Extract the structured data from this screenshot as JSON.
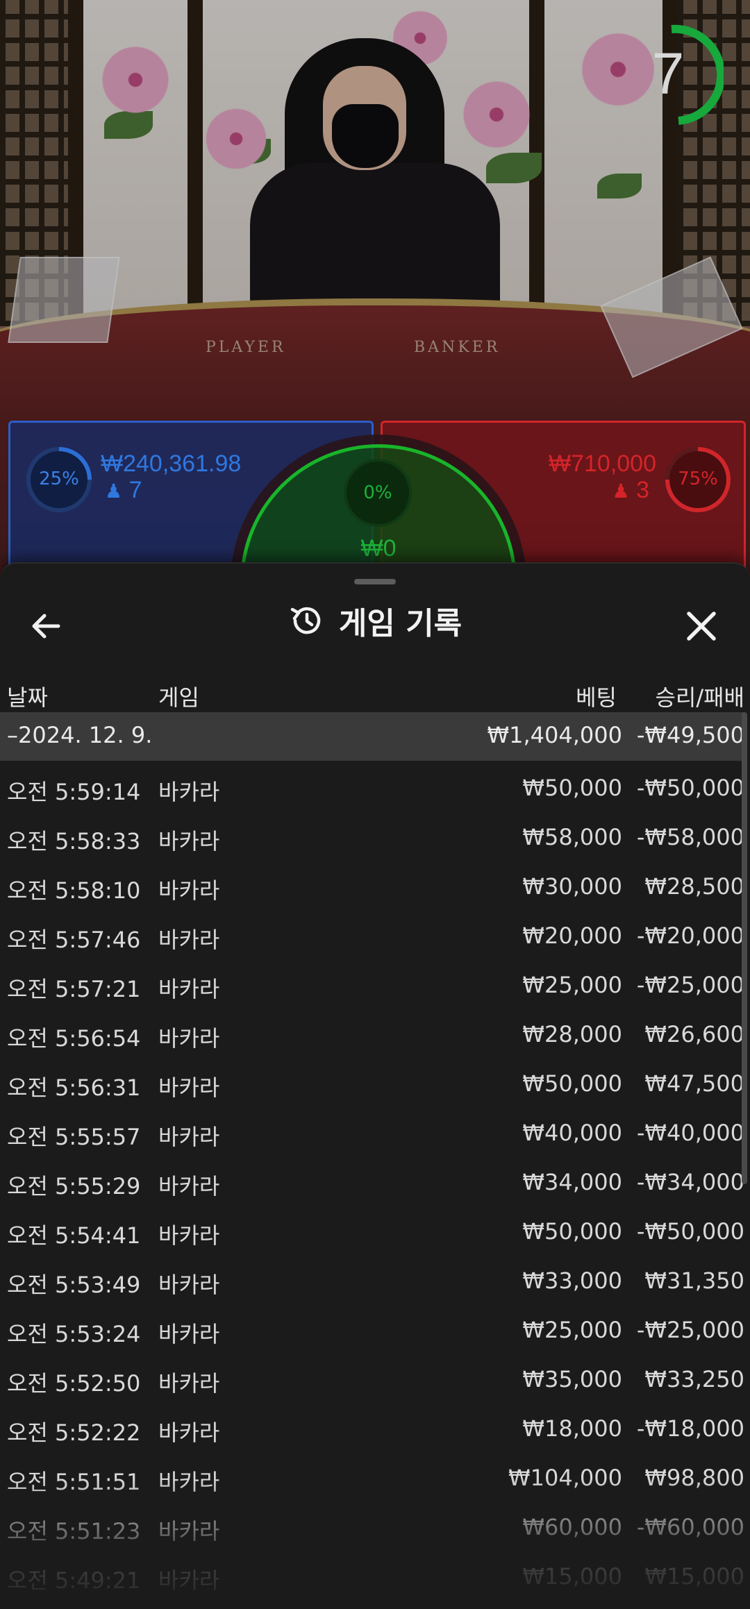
{
  "video": {
    "timer_value": "7",
    "table_labels": {
      "player": "PLAYER",
      "banker": "BANKER"
    },
    "player": {
      "amount": "₩240,361.98",
      "players": "7",
      "percent": "25%",
      "percent_value": 0.25,
      "color": "#2b6fd6"
    },
    "banker": {
      "amount": "₩710,000",
      "players": "3",
      "percent": "75%",
      "percent_value": 0.75,
      "color": "#d0262b"
    },
    "tie": {
      "percent": "0%",
      "amount": "₩0",
      "color": "#1db33a"
    }
  },
  "sheet": {
    "title": "게임 기록",
    "icons": {
      "back": "arrow-left-icon",
      "history": "history-icon",
      "close": "close-icon"
    },
    "columns": {
      "date": "날짜",
      "game": "게임",
      "bet": "베팅",
      "result": "승리/패배"
    },
    "date_group": {
      "label": "–2024. 12. 9.",
      "total_bet": "₩1,404,000",
      "total_result": "-₩49,500"
    },
    "rows": [
      {
        "time": "오전 5:59:14",
        "game": "바카라",
        "bet": "₩50,000",
        "result": "-₩50,000"
      },
      {
        "time": "오전 5:58:33",
        "game": "바카라",
        "bet": "₩58,000",
        "result": "-₩58,000"
      },
      {
        "time": "오전 5:58:10",
        "game": "바카라",
        "bet": "₩30,000",
        "result": "₩28,500"
      },
      {
        "time": "오전 5:57:46",
        "game": "바카라",
        "bet": "₩20,000",
        "result": "-₩20,000"
      },
      {
        "time": "오전 5:57:21",
        "game": "바카라",
        "bet": "₩25,000",
        "result": "-₩25,000"
      },
      {
        "time": "오전 5:56:54",
        "game": "바카라",
        "bet": "₩28,000",
        "result": "₩26,600"
      },
      {
        "time": "오전 5:56:31",
        "game": "바카라",
        "bet": "₩50,000",
        "result": "₩47,500"
      },
      {
        "time": "오전 5:55:57",
        "game": "바카라",
        "bet": "₩40,000",
        "result": "-₩40,000"
      },
      {
        "time": "오전 5:55:29",
        "game": "바카라",
        "bet": "₩34,000",
        "result": "-₩34,000"
      },
      {
        "time": "오전 5:54:41",
        "game": "바카라",
        "bet": "₩50,000",
        "result": "-₩50,000"
      },
      {
        "time": "오전 5:53:49",
        "game": "바카라",
        "bet": "₩33,000",
        "result": "₩31,350"
      },
      {
        "time": "오전 5:53:24",
        "game": "바카라",
        "bet": "₩25,000",
        "result": "-₩25,000"
      },
      {
        "time": "오전 5:52:50",
        "game": "바카라",
        "bet": "₩35,000",
        "result": "₩33,250"
      },
      {
        "time": "오전 5:52:22",
        "game": "바카라",
        "bet": "₩18,000",
        "result": "-₩18,000"
      },
      {
        "time": "오전 5:51:51",
        "game": "바카라",
        "bet": "₩104,000",
        "result": "₩98,800"
      },
      {
        "time": "오전 5:51:23",
        "game": "바카라",
        "bet": "₩60,000",
        "result": "-₩60,000"
      },
      {
        "time": "오전 5:49:21",
        "game": "바카라",
        "bet": "₩15,000",
        "result": "₩15,000"
      }
    ]
  }
}
